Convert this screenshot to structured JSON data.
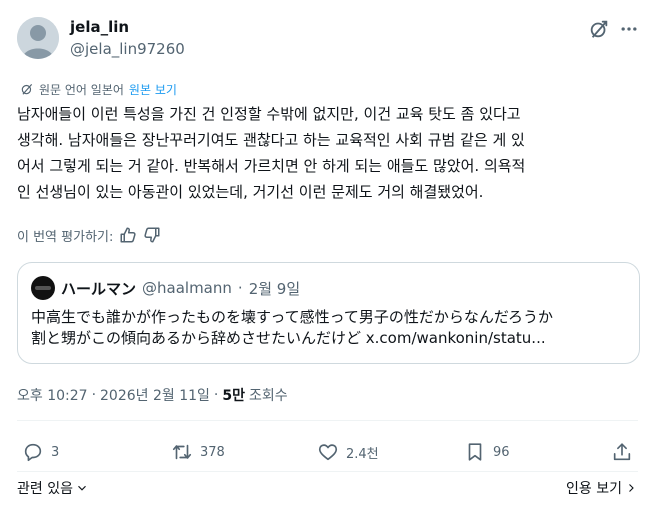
{
  "author": {
    "display_name": "jela_lin",
    "handle": "@jela_lin97260"
  },
  "header_icons": [
    "grok-slash-icon",
    "more-icon"
  ],
  "translation": {
    "notice": "원문 언어 일본어",
    "show_original": "원본 보기"
  },
  "tweet_lines": [
    "남자애들이 이런 특성을 가진 건 인정할 수밖에 없지만, 이건 교육 탓도 좀 있다고",
    "생각해. 남자애들은 장난꾸러기여도 괜찮다고 하는 교육적인 사회 규범 같은 게 있",
    "어서 그렇게 되는 거 같아. 반복해서 가르치면 안 하게 되는 애들도 많았어. 의욕적",
    "인 선생님이 있는 아동관이 있었는데, 거기선 이런 문제도 거의 해결됐었어."
  ],
  "rate_translation": "이 번역 평가하기:",
  "quote": {
    "display_name": "ハールマン",
    "handle": "@haalmann",
    "separator": "·",
    "date": "2월 9일",
    "lines": [
      "中高生でも誰かが作ったものを壊すって感性って男子の性だからなんだろうか",
      "割と甥がこの傾向あるから辞めさせたいんだけど x.com/wankonin/statu..."
    ]
  },
  "timestamp": {
    "time": "오후 10:27",
    "sep1": "·",
    "date": "2026년 2월 11일",
    "sep2": "·",
    "views_count": "5만",
    "views_label": "조회수"
  },
  "actions": {
    "replies": "3",
    "reposts": "378",
    "likes": "2.4천",
    "bookmarks": "96"
  },
  "footer": {
    "related": "관련 있음",
    "view_quotes": "인용 보기"
  }
}
